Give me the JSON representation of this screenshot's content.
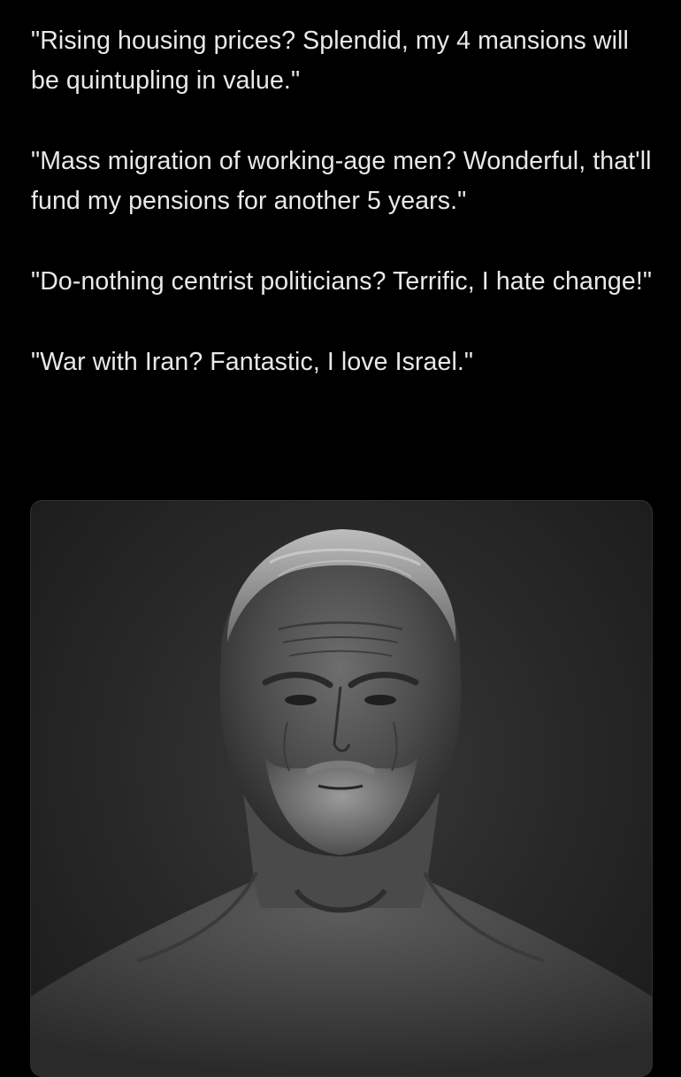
{
  "post": {
    "paragraphs": [
      "\"Rising housing prices? Splendid, my 4 mansions will be quintupling in value.\"",
      "\"Mass migration of working-age men? Wonderful, that'll fund my pensions for another 5 years.\"",
      "\"Do-nothing centrist politicians? Terrific, I hate change!\"",
      "\"War with Iran? Fantastic, I love Israel.\""
    ]
  },
  "media": {
    "subject": "grayscale portrait of an older muscular man with slicked-back gray hair and gray beard"
  },
  "colors": {
    "background": "#000000",
    "text": "#e7e9ea",
    "media_border": "#2f3336"
  }
}
